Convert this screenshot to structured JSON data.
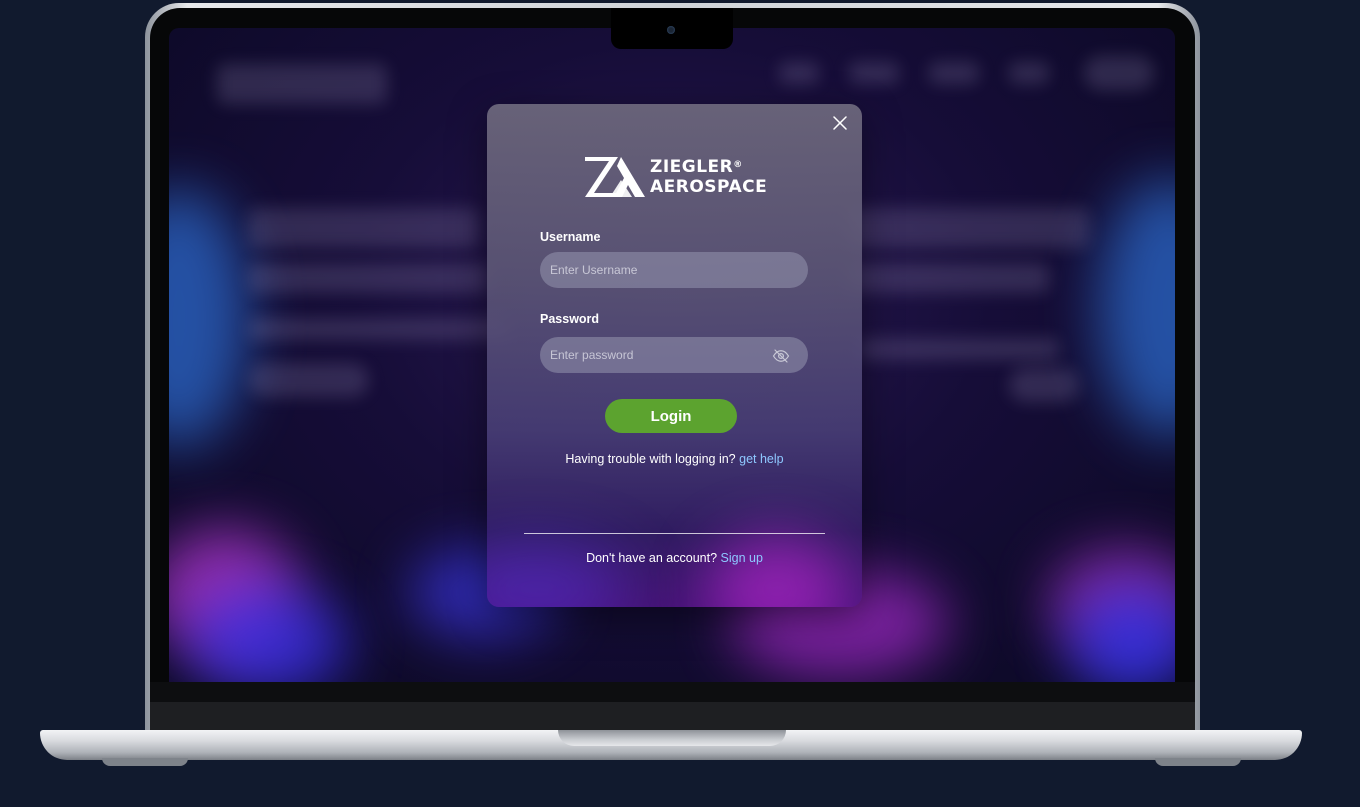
{
  "logo": {
    "line1": "ZIEGLER",
    "registered": "®",
    "line2": "AEROSPACE"
  },
  "form": {
    "username_label": "Username",
    "username_placeholder": "Enter Username",
    "password_label": "Password",
    "password_placeholder": "Enter password",
    "login_label": "Login"
  },
  "help": {
    "text": "Having trouble with logging in?",
    "link": "get help"
  },
  "signup": {
    "text": "Don't have an account?",
    "link": "Sign up"
  },
  "icons": {
    "close": "close-icon",
    "password_toggle": "eye-off-icon"
  },
  "colors": {
    "background": "#111a2e",
    "login_button": "#5ca32f",
    "link": "#8ec8ff"
  }
}
